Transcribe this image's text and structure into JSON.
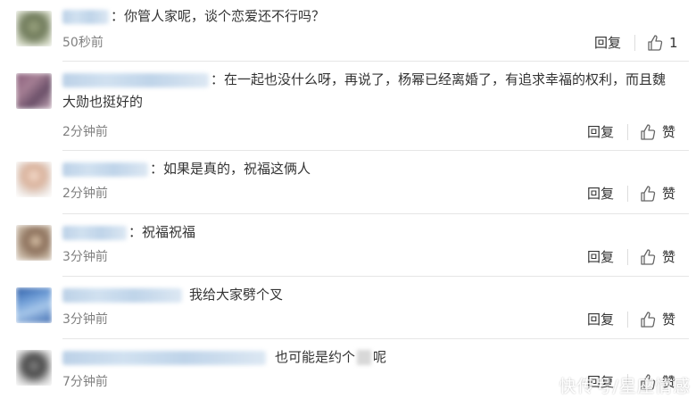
{
  "comments": [
    {
      "text": "：你管人家呢，谈个恋爱还不行吗？",
      "time": "50秒前",
      "reply": "回复",
      "like": "1"
    },
    {
      "text": "：在一起也没什么呀，再说了，杨幂已经离婚了，有追求幸福的权利，而且魏大勋也挺好的",
      "time": "2分钟前",
      "reply": "回复",
      "like": "赞"
    },
    {
      "text": "：如果是真的，祝福这俩人",
      "time": "2分钟前",
      "reply": "回复",
      "like": "赞"
    },
    {
      "text": "：祝福祝福",
      "time": "3分钟前",
      "reply": "回复",
      "like": "赞"
    },
    {
      "text": "我给大家劈个叉",
      "time": "3分钟前",
      "reply": "回复",
      "like": "赞"
    },
    {
      "text_a": "也可能是约个",
      "text_b": "呢",
      "time": "7分钟前",
      "reply": "回复",
      "like": "赞"
    }
  ],
  "watermark": "快传号/星座情感"
}
